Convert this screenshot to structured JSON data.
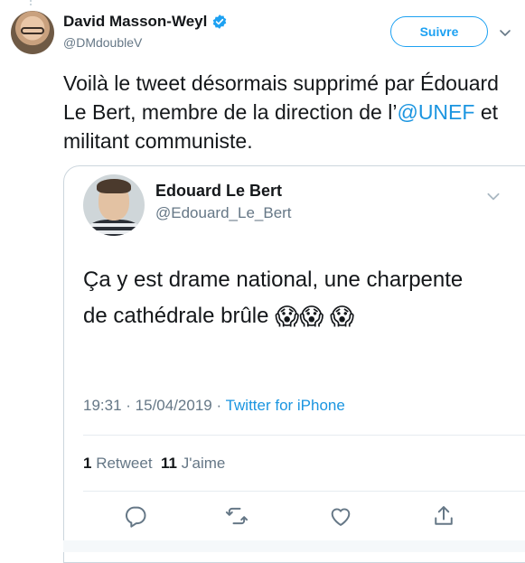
{
  "author": {
    "display_name": "David Masson-Weyl",
    "handle": "@DMdoubleV",
    "follow_label": "Suivre",
    "verified": true
  },
  "tweet": {
    "text_part1": "Voilà le tweet désormais supprimé par Édouard Le Bert, membre de la direction de l’",
    "mention": "@UNEF",
    "text_part2": " et militant communiste."
  },
  "quoted": {
    "display_name": "Edouard Le Bert",
    "handle": "@Edouard_Le_Bert",
    "text": "Ça y est drame national, une charpente de cathédrale brûle",
    "emoji1": "😱",
    "emoji2": "😱",
    "emoji3": "😱",
    "time": "19:31",
    "sep1": " · ",
    "date": "15/04/2019",
    "sep2": " · ",
    "source": "Twitter for iPhone",
    "retweet_count": "1",
    "retweet_label": "Retweet",
    "like_count": "11",
    "like_label": "J'aime"
  },
  "icons": {
    "verified": "verified-badge-icon",
    "chevron": "chevron-down-icon",
    "reply": "reply-icon",
    "retweet": "retweet-icon",
    "like": "heart-icon",
    "share": "share-icon"
  },
  "colors": {
    "accent": "#1da1f2",
    "link": "#1b95e0",
    "secondary_text": "#657786",
    "border": "#ccd6dd"
  }
}
